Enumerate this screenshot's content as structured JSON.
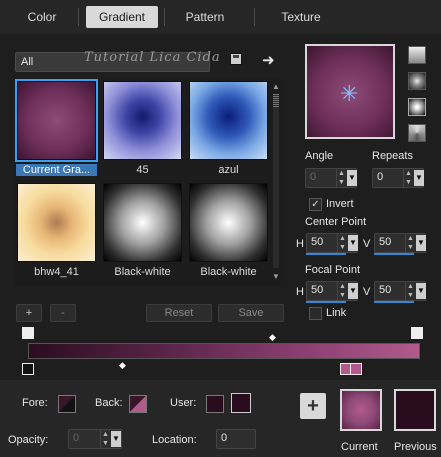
{
  "tabs": [
    {
      "label": "Color",
      "active": false
    },
    {
      "label": "Gradient",
      "active": true
    },
    {
      "label": "Pattern",
      "active": false
    },
    {
      "label": "Texture",
      "active": false
    }
  ],
  "library": {
    "filter_value": "All",
    "watermark": "Tutorial Lica Cida",
    "items": [
      {
        "label": "Current Gra...",
        "selected": true
      },
      {
        "label": "45",
        "selected": false
      },
      {
        "label": "azul",
        "selected": false
      },
      {
        "label": "bhw4_41",
        "selected": false
      },
      {
        "label": "Black-white",
        "selected": false
      },
      {
        "label": "Black-white",
        "selected": false
      }
    ],
    "icons": [
      "save-preset-icon",
      "arrow-right-icon"
    ]
  },
  "buttons": {
    "add": "+",
    "remove": "-",
    "reset": "Reset",
    "save": "Save"
  },
  "settings": {
    "angle_label": "Angle",
    "angle_value": "0",
    "repeats_label": "Repeats",
    "repeats_value": "0",
    "invert_label": "Invert",
    "invert_checked": true,
    "center_point_label": "Center Point",
    "center_h_label": "H",
    "center_h_value": "50",
    "center_v_label": "V",
    "center_v_value": "50",
    "focal_point_label": "Focal Point",
    "focal_h_label": "H",
    "focal_h_value": "50",
    "focal_v_label": "V",
    "focal_v_value": "50",
    "link_label": "Link",
    "link_checked": false
  },
  "bottom": {
    "fore_label": "Fore:",
    "back_label": "Back:",
    "user_label": "User:",
    "opacity_label": "Opacity:",
    "opacity_value": "0",
    "location_label": "Location:",
    "location_value": "0",
    "current_label": "Current",
    "previous_label": "Previous",
    "add_label": "+"
  },
  "colors": {
    "accent": "#3aa0f0",
    "fore": "#3a1428",
    "back": "#b25a8c",
    "user1": "#2a0c1f",
    "user2": "#2a0c1f",
    "current": "#8e4a78",
    "previous": "#2a0c1f"
  }
}
